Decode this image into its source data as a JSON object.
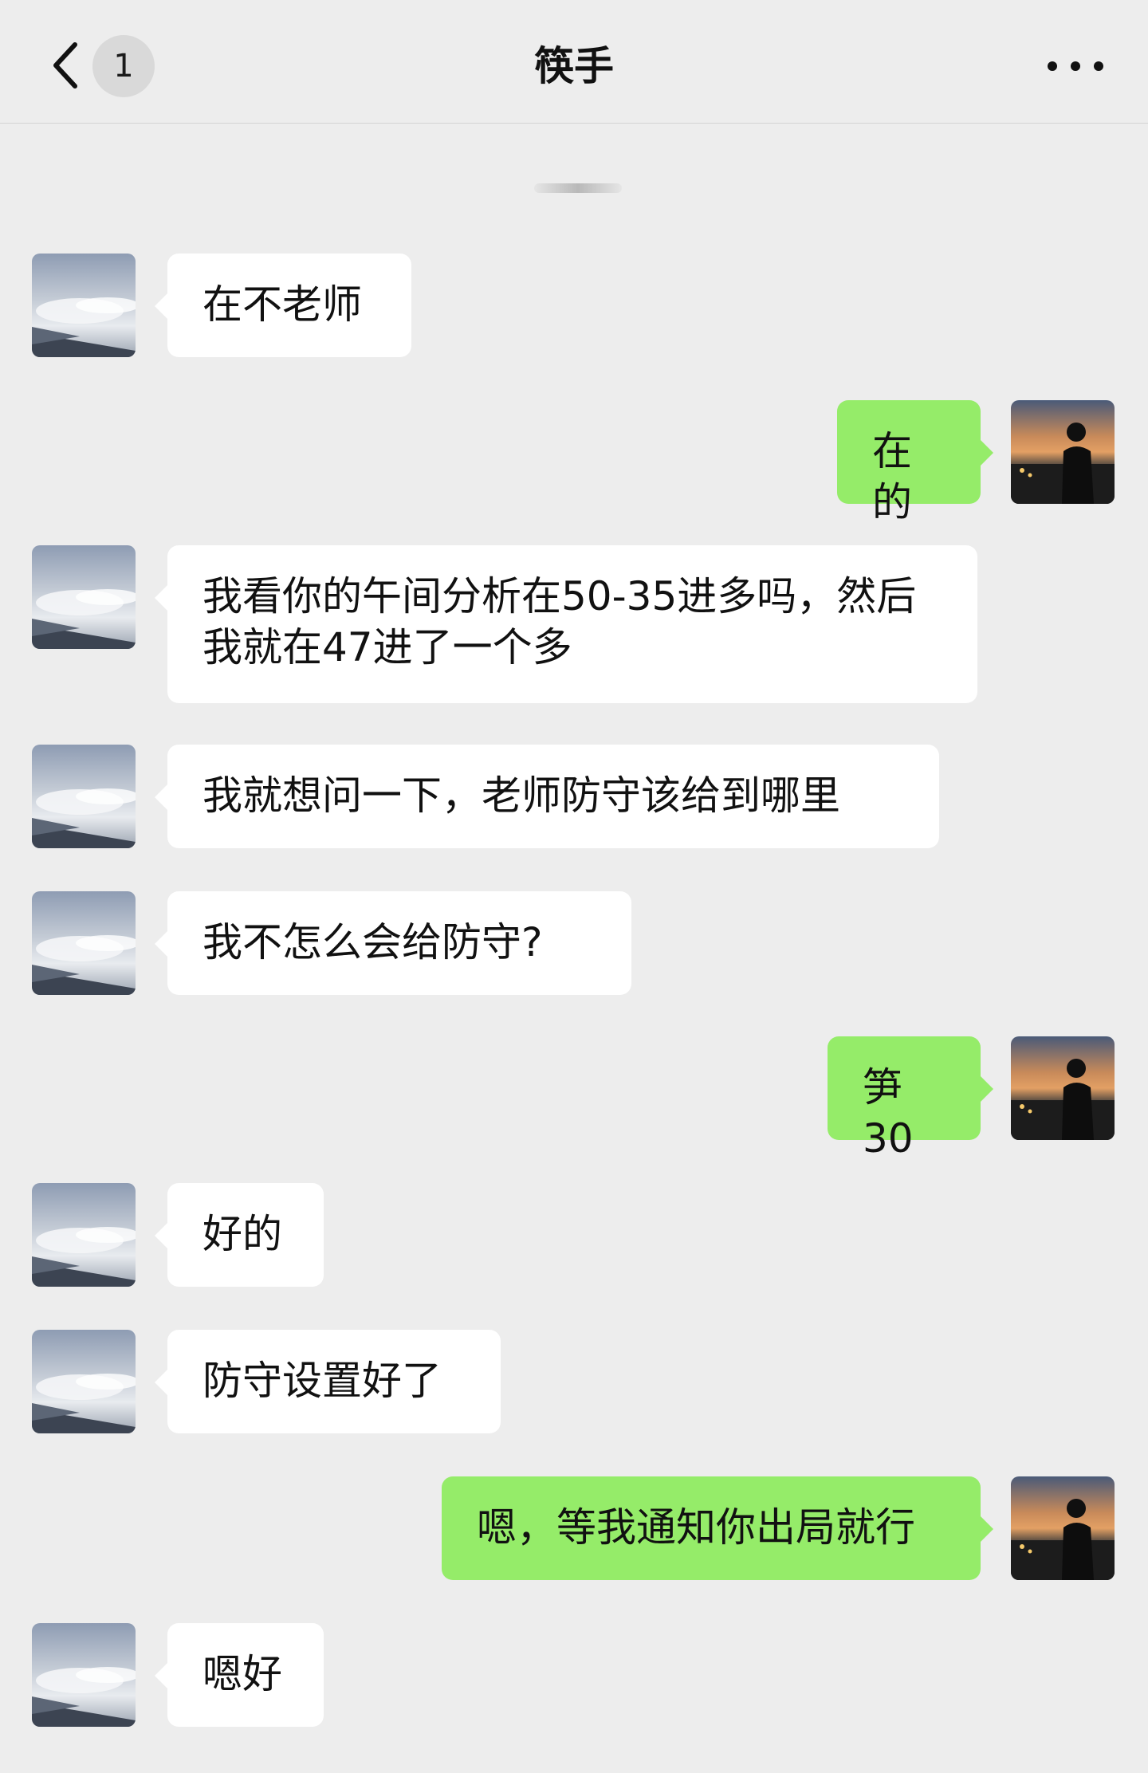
{
  "header": {
    "title": "筷手",
    "unread_count": "1"
  },
  "messages": [
    {
      "side": "left",
      "text": "在不老师"
    },
    {
      "side": "right",
      "text": "在的"
    },
    {
      "side": "left",
      "text": "我看你的午间分析在50-35进多吗，然后我就在47进了一个多"
    },
    {
      "side": "left",
      "text": "我就想问一下，老师防守该给到哪里"
    },
    {
      "side": "left",
      "text": "我不怎么会给防守?"
    },
    {
      "side": "right",
      "text": "笋30"
    },
    {
      "side": "left",
      "text": "好的"
    },
    {
      "side": "left",
      "text": "防守设置好了"
    },
    {
      "side": "right",
      "text": "嗯，等我通知你出局就行"
    },
    {
      "side": "left",
      "text": "嗯好"
    }
  ],
  "colors": {
    "background": "#ededed",
    "left_bubble": "#ffffff",
    "right_bubble": "#95ec69"
  },
  "icons": {
    "back": "chevron-left-icon",
    "more": "more-dots-icon",
    "contact_avatar": "cloud-wing-photo",
    "self_avatar": "sunset-silhouette-photo"
  }
}
